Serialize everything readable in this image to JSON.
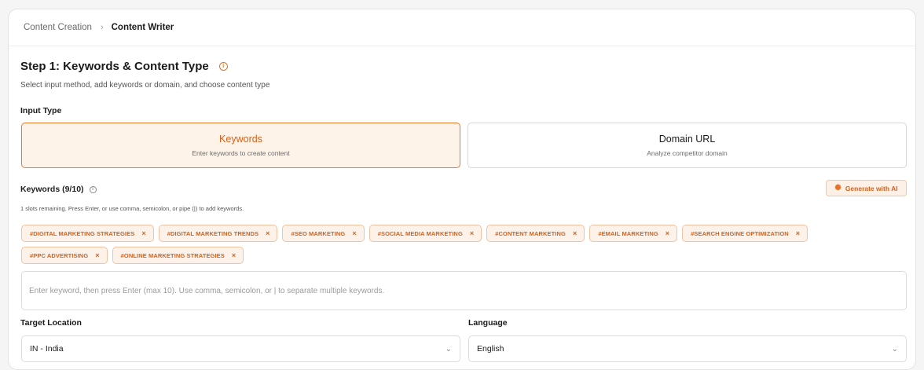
{
  "breadcrumb": {
    "parent": "Content Creation",
    "separator": "›",
    "current": "Content Writer"
  },
  "step": {
    "title": "Step 1: Keywords & Content Type",
    "info_icon": "info-icon",
    "subtitle": "Select input method, add keywords or domain, and choose content type"
  },
  "input_type": {
    "label": "Input Type",
    "options": [
      {
        "title": "Keywords",
        "description": "Enter keywords to create content",
        "selected": true
      },
      {
        "title": "Domain URL",
        "description": "Analyze competitor domain",
        "selected": false
      }
    ]
  },
  "keywords": {
    "label": "Keywords (9/10)",
    "generate_button": "Generate with AI",
    "generate_icon": "sparkle-icon",
    "slots_hint": "1 slots remaining. Press Enter, or use comma, semicolon, or pipe (|) to add keywords.",
    "remove_glyph": "×",
    "tags": [
      "#DIGITAL MARKETING STRATEGIES",
      "#DIGITAL MARKETING TRENDS",
      "#SEO MARKETING",
      "#SOCIAL MEDIA MARKETING",
      "#CONTENT MARKETING",
      "#EMAIL MARKETING",
      "#SEARCH ENGINE OPTIMIZATION",
      "#PPC ADVERTISING",
      "#ONLINE MARKETING STRATEGIES"
    ],
    "input_value": "",
    "input_placeholder": "Enter keyword, then press Enter (max 10). Use comma, semicolon, or | to separate multiple keywords."
  },
  "target_location": {
    "label": "Target Location",
    "value": "IN - India"
  },
  "language": {
    "label": "Language",
    "value": "English"
  },
  "colors": {
    "accent": "#e8701e",
    "accent_bg": "#fdf3e9",
    "border": "#dcdcdc"
  }
}
